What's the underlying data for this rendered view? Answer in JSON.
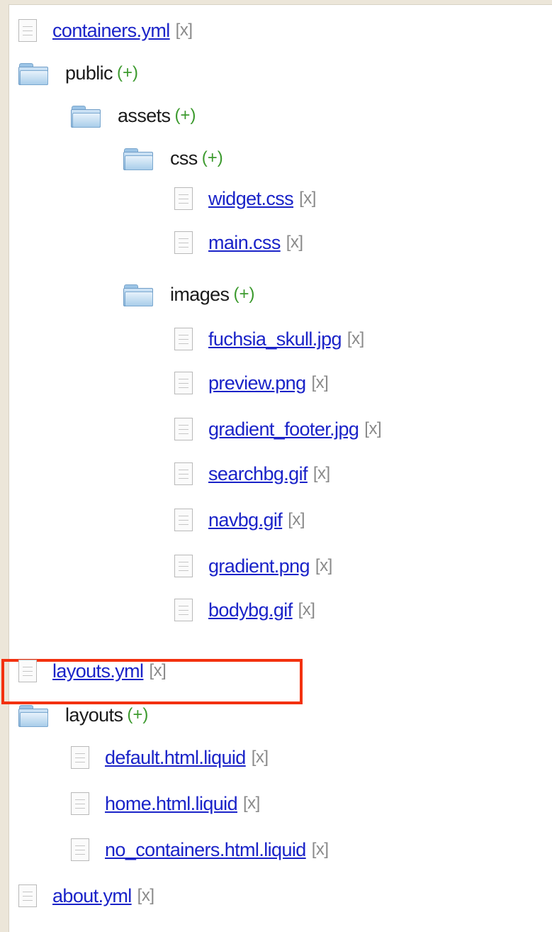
{
  "tree": [
    {
      "type": "file",
      "name": "containers.yml",
      "action": "[x]"
    },
    {
      "type": "folder",
      "name": "public",
      "action": "(+)"
    },
    {
      "type": "folder",
      "name": "assets",
      "action": "(+)"
    },
    {
      "type": "folder",
      "name": "css",
      "action": "(+)"
    },
    {
      "type": "file",
      "name": "widget.css",
      "action": "[x]"
    },
    {
      "type": "file",
      "name": "main.css",
      "action": "[x]"
    },
    {
      "type": "folder",
      "name": "images",
      "action": "(+)"
    },
    {
      "type": "file",
      "name": "fuchsia_skull.jpg",
      "action": "[x]"
    },
    {
      "type": "file",
      "name": "preview.png",
      "action": "[x]"
    },
    {
      "type": "file",
      "name": "gradient_footer.jpg",
      "action": "[x]"
    },
    {
      "type": "file",
      "name": "searchbg.gif",
      "action": "[x]"
    },
    {
      "type": "file",
      "name": "navbg.gif",
      "action": "[x]"
    },
    {
      "type": "file",
      "name": "gradient.png",
      "action": "[x]"
    },
    {
      "type": "file",
      "name": "bodybg.gif",
      "action": "[x]"
    },
    {
      "type": "file",
      "name": "layouts.yml",
      "action": "[x]",
      "highlighted": true
    },
    {
      "type": "folder",
      "name": "layouts",
      "action": "(+)"
    },
    {
      "type": "file",
      "name": "default.html.liquid",
      "action": "[x]"
    },
    {
      "type": "file",
      "name": "home.html.liquid",
      "action": "[x]"
    },
    {
      "type": "file",
      "name": "no_containers.html.liquid",
      "action": "[x]"
    },
    {
      "type": "file",
      "name": "about.yml",
      "action": "[x]"
    }
  ],
  "colors": {
    "link": "#1a23c8",
    "delete": "#8a8a8a",
    "add": "#3c9a2e",
    "highlight": "#f3310f",
    "page_background": "#ece6d9"
  }
}
